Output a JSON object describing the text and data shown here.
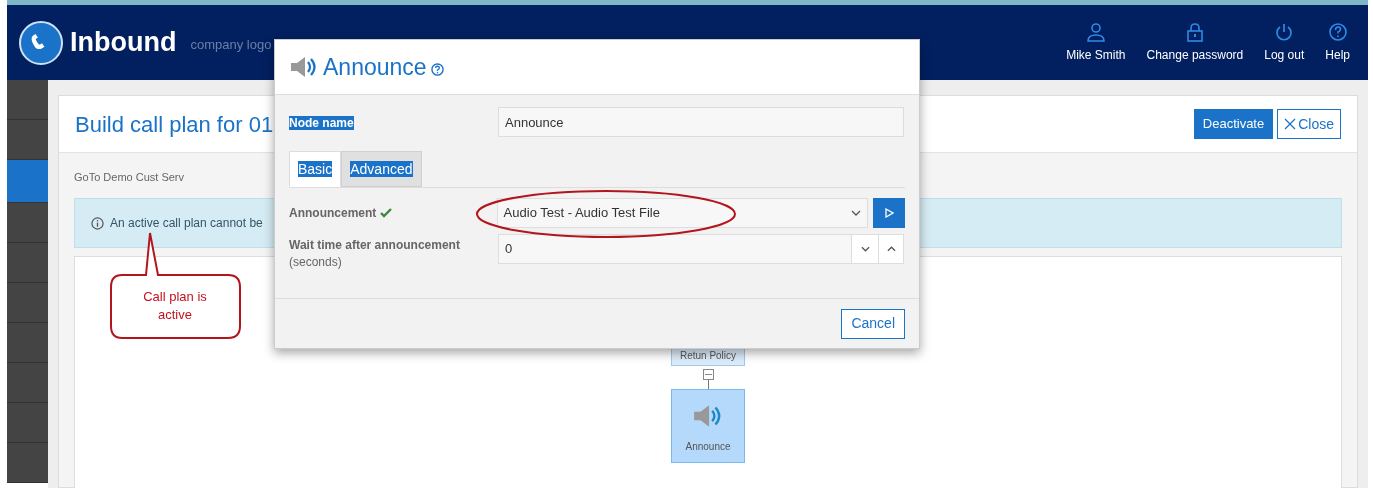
{
  "header": {
    "app_name": "Inbound",
    "company_logo": "company logo",
    "menu": [
      {
        "kind": "user",
        "label": "Mike Smith"
      },
      {
        "kind": "lock",
        "label": "Change password"
      },
      {
        "kind": "power",
        "label": "Log out"
      },
      {
        "kind": "help",
        "label": "Help"
      }
    ]
  },
  "sidebar": {
    "items": [
      {
        "selected": false
      },
      {
        "selected": false
      },
      {
        "selected": true
      },
      {
        "selected": false
      },
      {
        "selected": false
      },
      {
        "selected": false
      },
      {
        "selected": false
      },
      {
        "selected": false
      },
      {
        "selected": false
      },
      {
        "selected": false
      }
    ]
  },
  "page": {
    "title": "Build call plan for 01",
    "buttons": [
      {
        "kind": "primary",
        "label": "Deactivate"
      },
      {
        "kind": "close",
        "label": "Close"
      }
    ],
    "subtitle": "GoTo Demo Cust Serv",
    "info": "An active call plan cannot be",
    "nodes": [
      {
        "label": "Retun Policy",
        "selected": false
      },
      {
        "label": "Announce",
        "selected": true
      }
    ]
  },
  "callout": {
    "text": "Call plan is active"
  },
  "modal": {
    "title": "Announce",
    "node_name_label": "Node name",
    "node_name": "Announce",
    "tabs": [
      {
        "label": "Basic",
        "selected": true
      },
      {
        "label": "Advanced",
        "selected": false
      }
    ],
    "announcement": {
      "label": "Announcement",
      "valid": true,
      "value": "Audio Test - Audio Test File"
    },
    "wait_time": {
      "label": "Wait time after announcement",
      "unit": "(seconds)",
      "value": "0"
    },
    "cancel": "Cancel"
  }
}
